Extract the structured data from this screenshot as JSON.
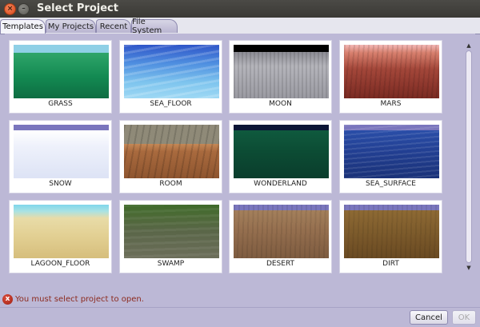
{
  "window": {
    "title": "Select Project",
    "close_glyph": "×",
    "minimize_glyph": "–"
  },
  "tabs": [
    {
      "label": "Templates",
      "active": true
    },
    {
      "label": "My Projects",
      "active": false
    },
    {
      "label": "Recent",
      "active": false
    },
    {
      "label": "File System",
      "active": false
    }
  ],
  "templates": [
    {
      "label": "GRASS"
    },
    {
      "label": "SEA_FLOOR"
    },
    {
      "label": "MOON"
    },
    {
      "label": "MARS"
    },
    {
      "label": "SNOW"
    },
    {
      "label": "ROOM"
    },
    {
      "label": "WONDERLAND"
    },
    {
      "label": "SEA_SURFACE"
    },
    {
      "label": "LAGOON_FLOOR"
    },
    {
      "label": "SWAMP"
    },
    {
      "label": "DESERT"
    },
    {
      "label": "DIRT"
    }
  ],
  "status": {
    "message": "You must select project to open.",
    "icon": "error-icon",
    "icon_glyph": "x"
  },
  "buttons": {
    "cancel": "Cancel",
    "ok": "OK"
  },
  "scrollbar": {
    "up_glyph": "▲",
    "down_glyph": "▼"
  }
}
